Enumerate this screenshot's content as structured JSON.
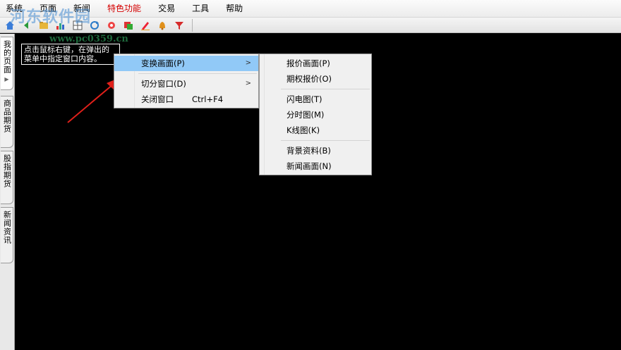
{
  "menubar": {
    "items": [
      "系统",
      "页面",
      "新闻",
      "特色功能",
      "交易",
      "工具",
      "帮助"
    ]
  },
  "watermark": {
    "title": "河东软件园",
    "url": "www.pc0359.cn"
  },
  "sidetabs": [
    {
      "label": "我的页面",
      "active": true
    },
    {
      "label": "商品期货",
      "active": false
    },
    {
      "label": "股指期货",
      "active": false
    },
    {
      "label": "新闻资讯",
      "active": false
    }
  ],
  "tooltip": {
    "line1": "点击鼠标右键，在弹出的",
    "line2": "菜单中指定窗口内容。"
  },
  "context_menu": {
    "items": [
      {
        "label": "变换画面(P)",
        "shortcut": "",
        "submenu": ">"
      },
      {
        "label": "切分窗口(D)",
        "shortcut": "",
        "submenu": ">"
      },
      {
        "label": "关闭窗口",
        "shortcut": "Ctrl+F4",
        "submenu": ""
      }
    ]
  },
  "submenu": {
    "items": [
      "报价画面(P)",
      "期权报价(O)",
      "闪电图(T)",
      "分时图(M)",
      "K线图(K)",
      "背景资料(B)",
      "新闻画面(N)"
    ]
  },
  "colors": {
    "highlight": "#91c9f7",
    "special_menu": "#d40000",
    "arrow": "#e0201a"
  }
}
